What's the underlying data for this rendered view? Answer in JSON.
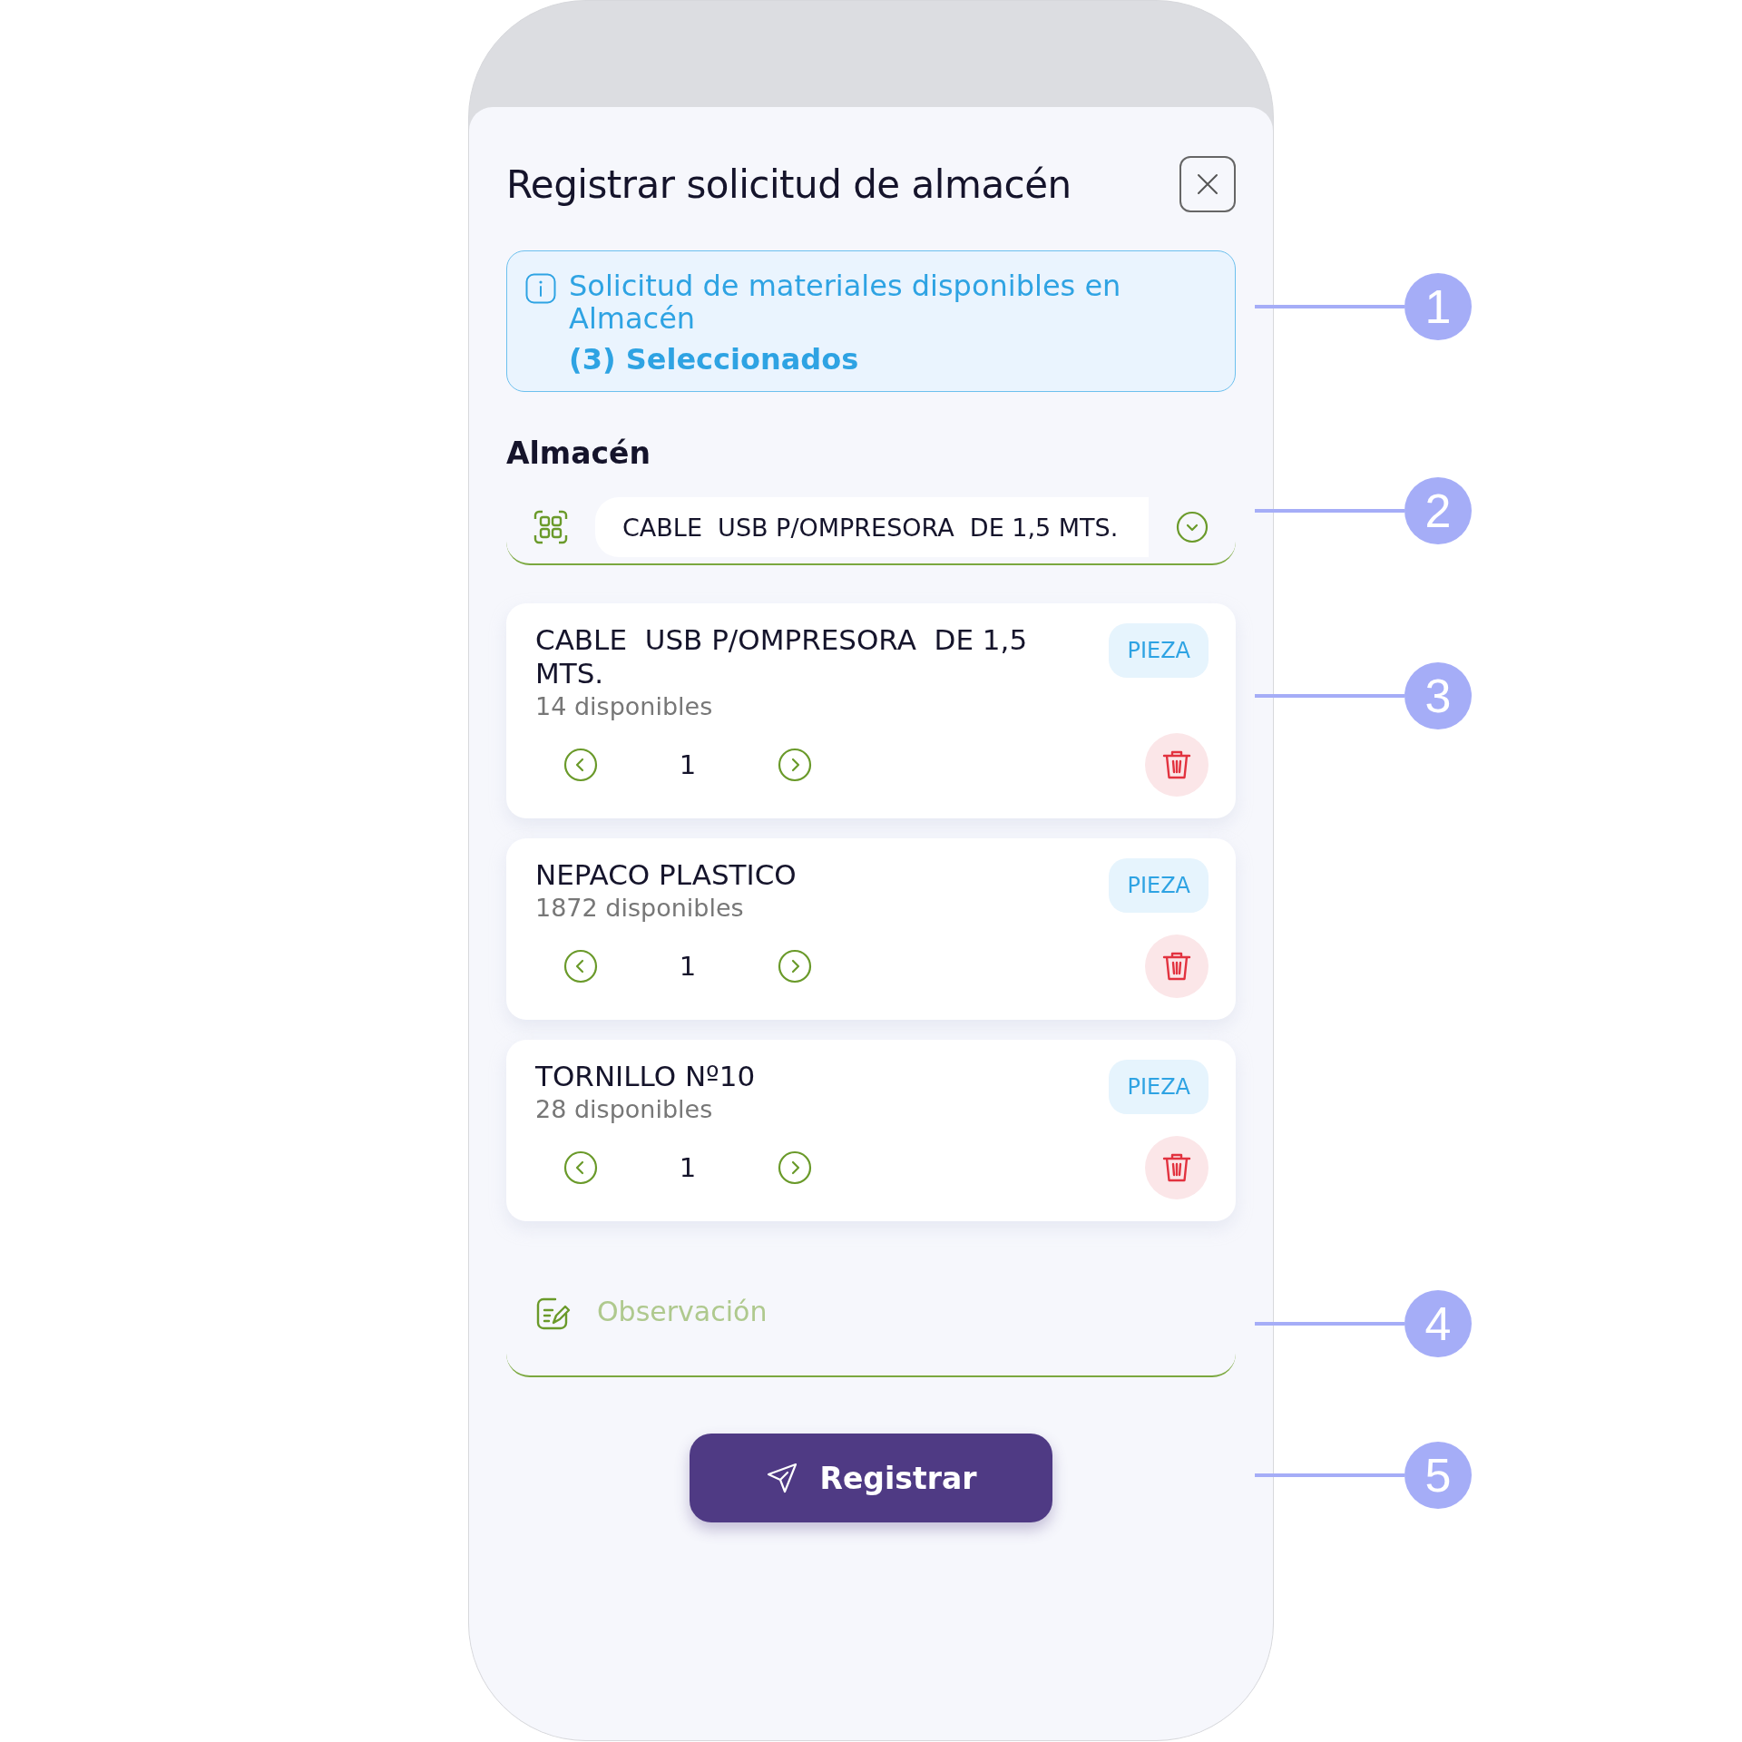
{
  "title": "Registrar solicitud de almacén",
  "info": {
    "text": "Solicitud de materiales disponibles en Almacén",
    "count": "(3) Seleccionados"
  },
  "warehouse": {
    "label": "Almacén",
    "value": "CABLE  USB P/OMPRESORA  DE 1,5 MTS."
  },
  "items": [
    {
      "name": "CABLE  USB P/OMPRESORA  DE 1,5 MTS.",
      "available": "14 disponibles",
      "unit": "PIEZA",
      "quantity": "1"
    },
    {
      "name": "NEPACO PLASTICO",
      "available": "1872 disponibles",
      "unit": "PIEZA",
      "quantity": "1"
    },
    {
      "name": "TORNILLO Nº10",
      "available": "28 disponibles",
      "unit": "PIEZA",
      "quantity": "1"
    }
  ],
  "observation": {
    "placeholder": "Observación"
  },
  "submit": "Registrar",
  "callouts": [
    "1",
    "2",
    "3",
    "4",
    "5"
  ]
}
